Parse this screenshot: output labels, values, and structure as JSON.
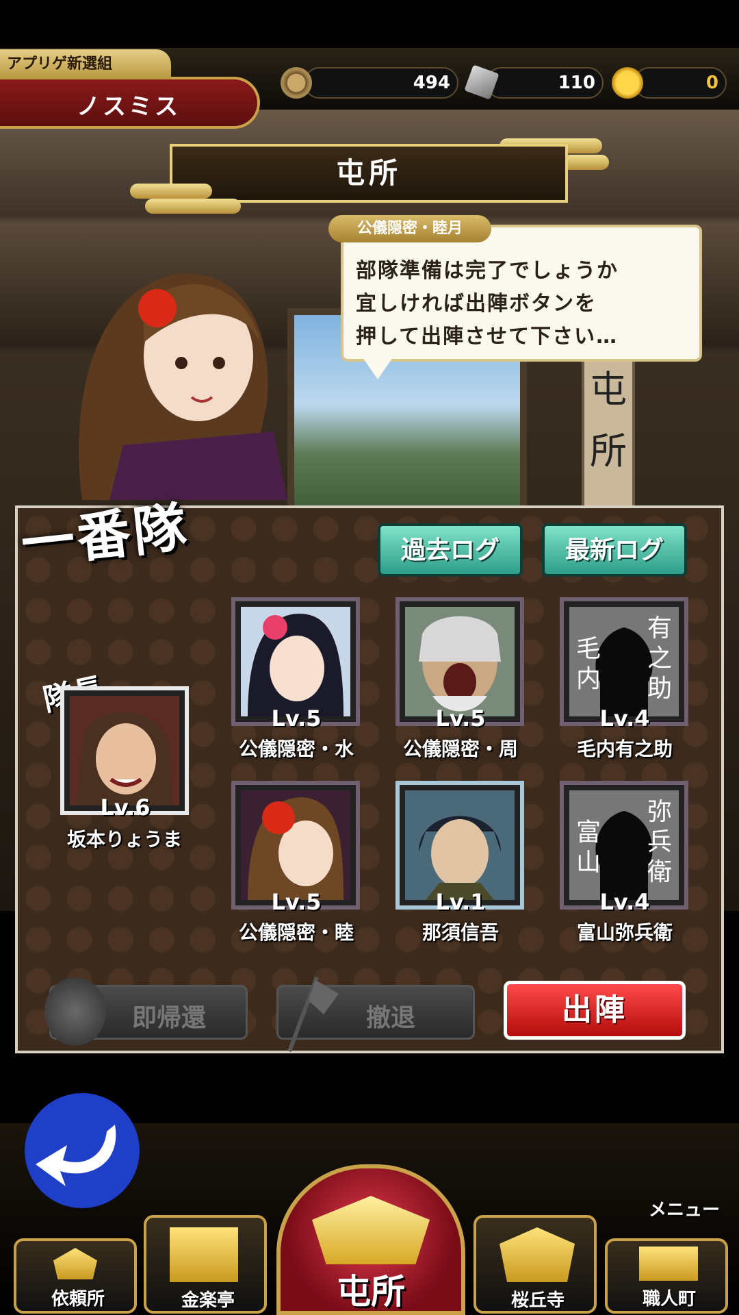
{
  "header": {
    "clan_name": "アプリゲ新選組",
    "player_name": "ノスミス",
    "resources": [
      {
        "icon": "coin-icon",
        "value": "494"
      },
      {
        "icon": "scroll-icon",
        "value": "110"
      },
      {
        "icon": "gold-icon",
        "value": "0"
      }
    ]
  },
  "title": "屯所",
  "speech": {
    "speaker": "公儀隠密・睦月",
    "lines": [
      "部隊準備は完了でしょうか",
      "宜しければ出陣ボタンを",
      "押して出陣させて下さい…"
    ]
  },
  "background_sign": [
    "屯",
    "所"
  ],
  "party": {
    "name": "一番隊",
    "log_buttons": {
      "past": "過去ログ",
      "latest": "最新ログ"
    },
    "leader_tag": "隊長",
    "leader": {
      "level": "Lv.6",
      "name": "坂本りょうま"
    },
    "members": [
      {
        "level": "Lv.5",
        "name": "公儀隠密・水",
        "silhouette": []
      },
      {
        "level": "Lv.5",
        "name": "公儀隠密・周",
        "silhouette": []
      },
      {
        "level": "Lv.4",
        "name": "毛内有之助",
        "silhouette": [
          "有",
          "之",
          "助",
          "毛",
          "内"
        ]
      },
      {
        "level": "Lv.5",
        "name": "公儀隠密・睦",
        "silhouette": []
      },
      {
        "level": "Lv.1",
        "name": "那須信吾",
        "silhouette": []
      },
      {
        "level": "Lv.4",
        "name": "富山弥兵衛",
        "silhouette": [
          "弥",
          "兵",
          "衛",
          "富",
          "山"
        ]
      }
    ],
    "actions": {
      "return": "即帰還",
      "retreat": "撤退",
      "sortie": "出陣"
    }
  },
  "nav": {
    "menu": "メニュー",
    "items": [
      "依頼所",
      "金楽亭",
      "屯所",
      "桜丘寺",
      "職人町"
    ]
  },
  "colors": {
    "accent_gold": "#c9a24a",
    "sortie_red": "#d11a1a",
    "log_teal": "#2f9e8a"
  }
}
